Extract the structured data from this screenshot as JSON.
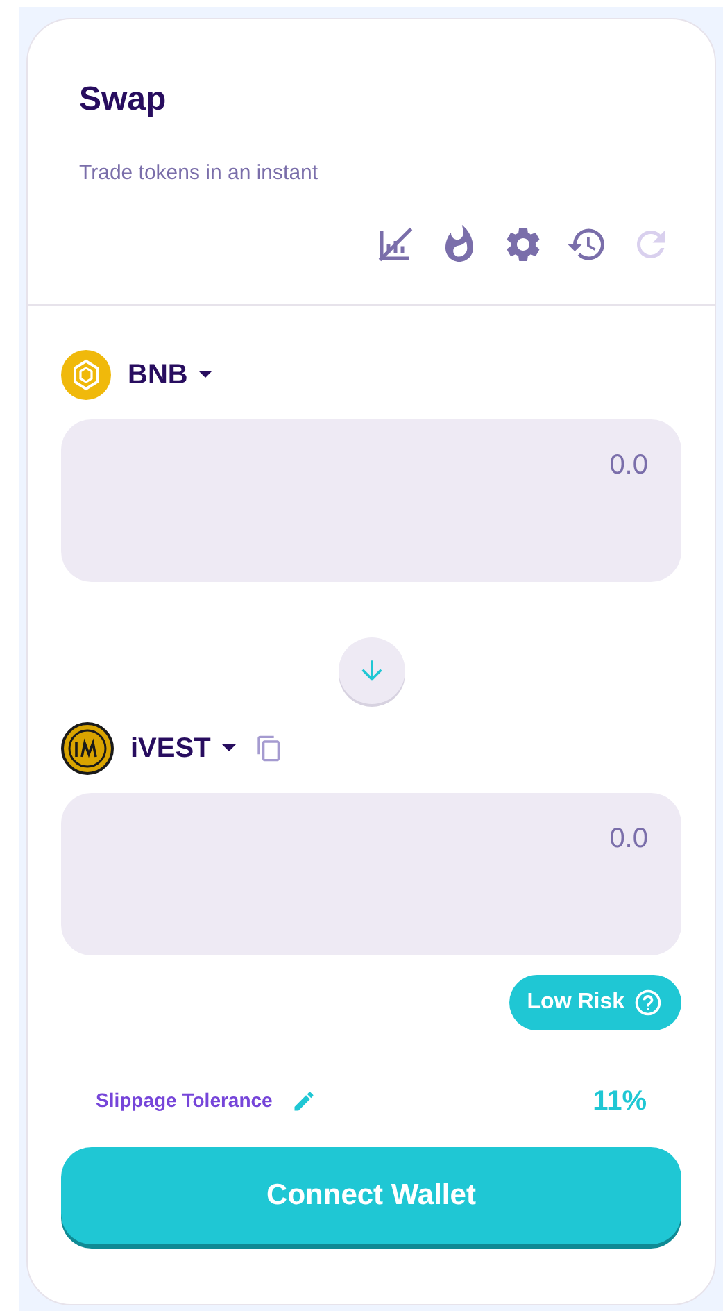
{
  "header": {
    "title": "Swap",
    "subtitle": "Trade tokens in an instant"
  },
  "toolbar": [
    {
      "kind": "chart",
      "disabled": false
    },
    {
      "kind": "fire",
      "disabled": false
    },
    {
      "kind": "settings",
      "disabled": false
    },
    {
      "kind": "history",
      "disabled": false
    },
    {
      "kind": "refresh",
      "disabled": true
    }
  ],
  "tokens": [
    {
      "symbol": "BNB",
      "kind": "bnb",
      "copyable": false,
      "amount_placeholder": "0.0"
    },
    {
      "symbol": "iVEST",
      "kind": "ivest",
      "copyable": true,
      "amount_placeholder": "0.0"
    }
  ],
  "risk_badge": "Low Risk",
  "slippage": {
    "label": "Slippage Tolerance",
    "value": "11%"
  },
  "connect_button": "Connect Wallet"
}
